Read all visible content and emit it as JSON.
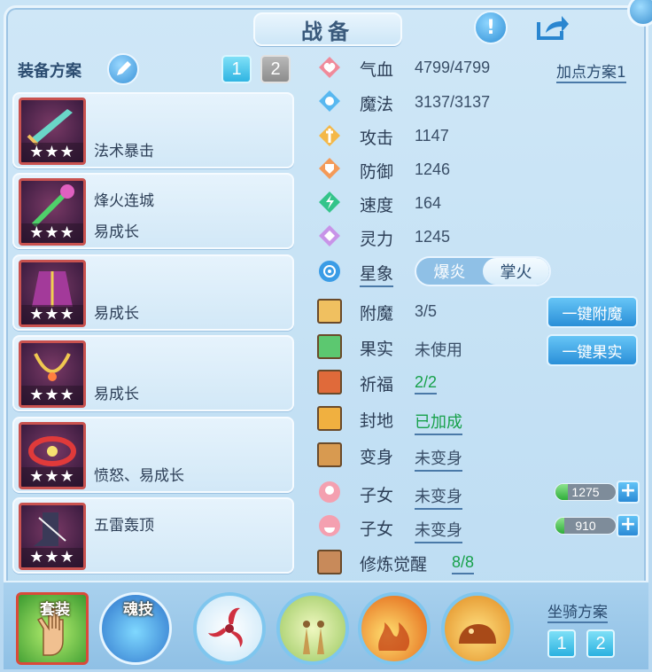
{
  "window": {
    "title": "战备"
  },
  "equip_plan": {
    "label": "装备方案",
    "tabs": [
      "1",
      "2"
    ],
    "active_tab": "1"
  },
  "equipment": [
    {
      "line1": "",
      "line2": "法术暴击",
      "stars": "★★★"
    },
    {
      "line1": "烽火连城",
      "line2": "易成长",
      "stars": "★★★"
    },
    {
      "line1": "",
      "line2": "易成长",
      "stars": "★★★"
    },
    {
      "line1": "",
      "line2": "易成长",
      "stars": "★★★"
    },
    {
      "line1": "",
      "line2": "愤怒、易成长",
      "stars": "★★★"
    },
    {
      "line1": "五雷轰顶",
      "line2": "",
      "stars": "★★★"
    }
  ],
  "stats": {
    "point_plan": "加点方案1",
    "hp": {
      "label": "气血",
      "value": "4799/4799"
    },
    "mp": {
      "label": "魔法",
      "value": "3137/3137"
    },
    "atk": {
      "label": "攻击",
      "value": "1147"
    },
    "def": {
      "label": "防御",
      "value": "1246"
    },
    "spd": {
      "label": "速度",
      "value": "164"
    },
    "spi": {
      "label": "灵力",
      "value": "1245"
    },
    "xingxiang": {
      "label": "星象",
      "options": [
        "爆炎",
        "掌火"
      ],
      "selected": "掌火"
    }
  },
  "extras": {
    "enchant": {
      "label": "附魔",
      "value": "3/5",
      "button": "一键附魔"
    },
    "fruit": {
      "label": "果实",
      "value": "未使用",
      "button": "一键果实"
    },
    "blessing": {
      "label": "祈福",
      "value": "2/2"
    },
    "seal": {
      "label": "封地",
      "value": "已加成"
    },
    "transform": {
      "label": "变身",
      "value": "未变身"
    },
    "child1": {
      "label": "子女",
      "value": "未变身",
      "bar": "1275",
      "fill": 0.2
    },
    "child2": {
      "label": "子女",
      "value": "未变身",
      "bar": "910",
      "fill": 0.15
    },
    "cultivation": {
      "label": "修炼觉醒",
      "value": "8/8"
    }
  },
  "bottom": {
    "suit_label": "套装",
    "soul_label": "魂技",
    "mount_label": "坐骑方案",
    "mount_tabs": [
      "1",
      "2"
    ]
  },
  "colors": {
    "accent": "#2a8fd8",
    "green_value": "#17a14a",
    "equip_border": "#c9524f"
  }
}
